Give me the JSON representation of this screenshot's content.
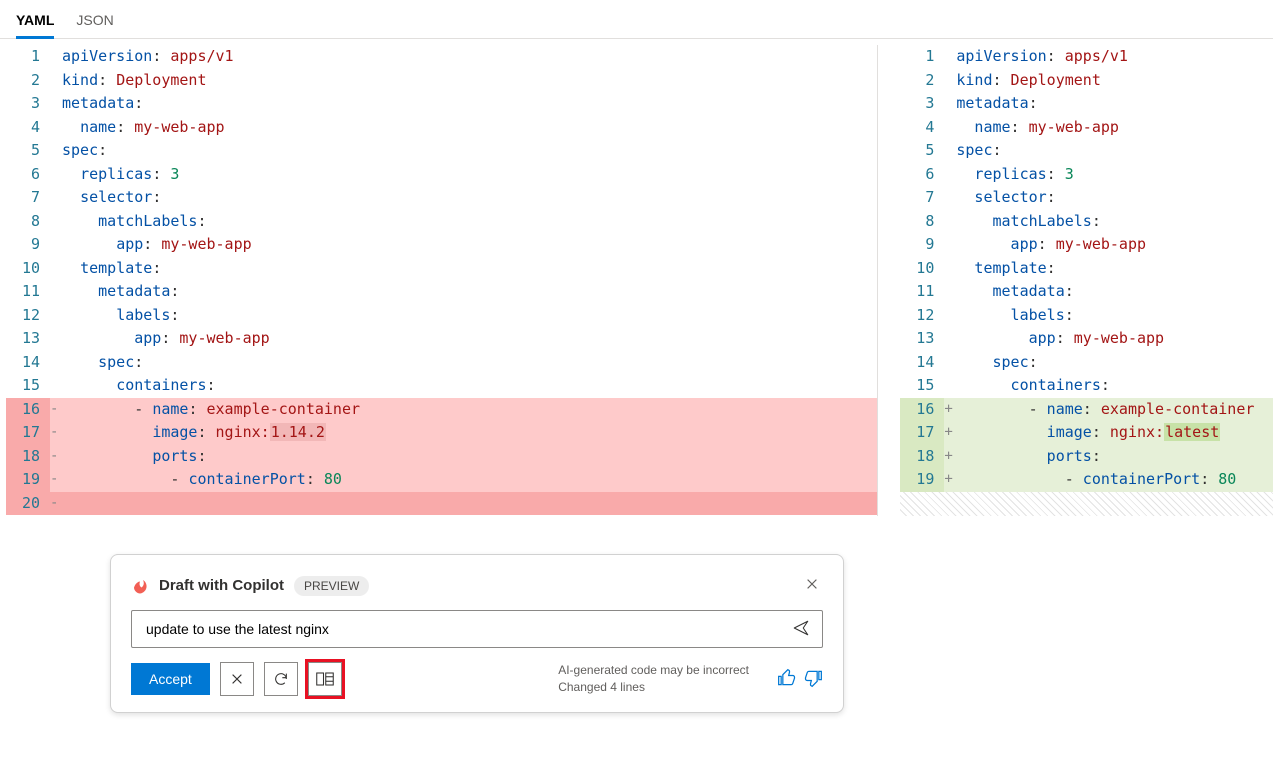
{
  "tabs": {
    "yaml": "YAML",
    "json": "JSON"
  },
  "left": {
    "lines": [
      {
        "n": 1,
        "tokens": [
          {
            "t": "apiVersion",
            "c": "k"
          },
          {
            "t": ": "
          },
          {
            "t": "apps/v1",
            "c": "v"
          }
        ]
      },
      {
        "n": 2,
        "tokens": [
          {
            "t": "kind",
            "c": "k"
          },
          {
            "t": ": "
          },
          {
            "t": "Deployment",
            "c": "v"
          }
        ]
      },
      {
        "n": 3,
        "tokens": [
          {
            "t": "metadata",
            "c": "k"
          },
          {
            "t": ":"
          }
        ]
      },
      {
        "n": 4,
        "tokens": [
          {
            "t": "  "
          },
          {
            "t": "name",
            "c": "k"
          },
          {
            "t": ": "
          },
          {
            "t": "my-web-app",
            "c": "v"
          }
        ]
      },
      {
        "n": 5,
        "tokens": [
          {
            "t": "spec",
            "c": "k"
          },
          {
            "t": ":"
          }
        ]
      },
      {
        "n": 6,
        "tokens": [
          {
            "t": "  "
          },
          {
            "t": "replicas",
            "c": "k"
          },
          {
            "t": ": "
          },
          {
            "t": "3",
            "c": "n"
          }
        ]
      },
      {
        "n": 7,
        "tokens": [
          {
            "t": "  "
          },
          {
            "t": "selector",
            "c": "k"
          },
          {
            "t": ":"
          }
        ]
      },
      {
        "n": 8,
        "tokens": [
          {
            "t": "    "
          },
          {
            "t": "matchLabels",
            "c": "k"
          },
          {
            "t": ":"
          }
        ]
      },
      {
        "n": 9,
        "tokens": [
          {
            "t": "      "
          },
          {
            "t": "app",
            "c": "k"
          },
          {
            "t": ": "
          },
          {
            "t": "my-web-app",
            "c": "v"
          }
        ]
      },
      {
        "n": 10,
        "tokens": [
          {
            "t": "  "
          },
          {
            "t": "template",
            "c": "k"
          },
          {
            "t": ":"
          }
        ]
      },
      {
        "n": 11,
        "tokens": [
          {
            "t": "    "
          },
          {
            "t": "metadata",
            "c": "k"
          },
          {
            "t": ":"
          }
        ]
      },
      {
        "n": 12,
        "tokens": [
          {
            "t": "      "
          },
          {
            "t": "labels",
            "c": "k"
          },
          {
            "t": ":"
          }
        ]
      },
      {
        "n": 13,
        "tokens": [
          {
            "t": "        "
          },
          {
            "t": "app",
            "c": "k"
          },
          {
            "t": ": "
          },
          {
            "t": "my-web-app",
            "c": "v"
          }
        ]
      },
      {
        "n": 14,
        "tokens": [
          {
            "t": "    "
          },
          {
            "t": "spec",
            "c": "k"
          },
          {
            "t": ":"
          }
        ]
      },
      {
        "n": 15,
        "tokens": [
          {
            "t": "      "
          },
          {
            "t": "containers",
            "c": "k"
          },
          {
            "t": ":"
          }
        ]
      },
      {
        "n": 16,
        "mark": "-",
        "cls": "del",
        "tokens": [
          {
            "t": "        - "
          },
          {
            "t": "name",
            "c": "k"
          },
          {
            "t": ": "
          },
          {
            "t": "example-container",
            "c": "v"
          }
        ]
      },
      {
        "n": 17,
        "mark": "-",
        "cls": "del",
        "tokens": [
          {
            "t": "          "
          },
          {
            "t": "image",
            "c": "k"
          },
          {
            "t": ": "
          },
          {
            "t": "nginx:",
            "c": "v"
          },
          {
            "t": "1.14.2",
            "c": "v",
            "hl": "old"
          }
        ]
      },
      {
        "n": 18,
        "mark": "-",
        "cls": "del",
        "tokens": [
          {
            "t": "          "
          },
          {
            "t": "ports",
            "c": "k"
          },
          {
            "t": ":"
          }
        ]
      },
      {
        "n": 19,
        "mark": "-",
        "cls": "del",
        "tokens": [
          {
            "t": "            - "
          },
          {
            "t": "containerPort",
            "c": "k"
          },
          {
            "t": ": "
          },
          {
            "t": "80",
            "c": "n"
          }
        ]
      },
      {
        "n": 20,
        "mark": "-",
        "cls": "del-strong",
        "tokens": []
      }
    ]
  },
  "right": {
    "lines": [
      {
        "n": 1,
        "tokens": [
          {
            "t": "apiVersion",
            "c": "k"
          },
          {
            "t": ": "
          },
          {
            "t": "apps/v1",
            "c": "v"
          }
        ]
      },
      {
        "n": 2,
        "tokens": [
          {
            "t": "kind",
            "c": "k"
          },
          {
            "t": ": "
          },
          {
            "t": "Deployment",
            "c": "v"
          }
        ]
      },
      {
        "n": 3,
        "tokens": [
          {
            "t": "metadata",
            "c": "k"
          },
          {
            "t": ":"
          }
        ]
      },
      {
        "n": 4,
        "tokens": [
          {
            "t": "  "
          },
          {
            "t": "name",
            "c": "k"
          },
          {
            "t": ": "
          },
          {
            "t": "my-web-app",
            "c": "v"
          }
        ]
      },
      {
        "n": 5,
        "tokens": [
          {
            "t": "spec",
            "c": "k"
          },
          {
            "t": ":"
          }
        ]
      },
      {
        "n": 6,
        "tokens": [
          {
            "t": "  "
          },
          {
            "t": "replicas",
            "c": "k"
          },
          {
            "t": ": "
          },
          {
            "t": "3",
            "c": "n"
          }
        ]
      },
      {
        "n": 7,
        "tokens": [
          {
            "t": "  "
          },
          {
            "t": "selector",
            "c": "k"
          },
          {
            "t": ":"
          }
        ]
      },
      {
        "n": 8,
        "tokens": [
          {
            "t": "    "
          },
          {
            "t": "matchLabels",
            "c": "k"
          },
          {
            "t": ":"
          }
        ]
      },
      {
        "n": 9,
        "tokens": [
          {
            "t": "      "
          },
          {
            "t": "app",
            "c": "k"
          },
          {
            "t": ": "
          },
          {
            "t": "my-web-app",
            "c": "v"
          }
        ]
      },
      {
        "n": 10,
        "tokens": [
          {
            "t": "  "
          },
          {
            "t": "template",
            "c": "k"
          },
          {
            "t": ":"
          }
        ]
      },
      {
        "n": 11,
        "tokens": [
          {
            "t": "    "
          },
          {
            "t": "metadata",
            "c": "k"
          },
          {
            "t": ":"
          }
        ]
      },
      {
        "n": 12,
        "tokens": [
          {
            "t": "      "
          },
          {
            "t": "labels",
            "c": "k"
          },
          {
            "t": ":"
          }
        ]
      },
      {
        "n": 13,
        "tokens": [
          {
            "t": "        "
          },
          {
            "t": "app",
            "c": "k"
          },
          {
            "t": ": "
          },
          {
            "t": "my-web-app",
            "c": "v"
          }
        ]
      },
      {
        "n": 14,
        "tokens": [
          {
            "t": "    "
          },
          {
            "t": "spec",
            "c": "k"
          },
          {
            "t": ":"
          }
        ]
      },
      {
        "n": 15,
        "tokens": [
          {
            "t": "      "
          },
          {
            "t": "containers",
            "c": "k"
          },
          {
            "t": ":"
          }
        ]
      },
      {
        "n": 16,
        "mark": "+",
        "cls": "add",
        "tokens": [
          {
            "t": "        - "
          },
          {
            "t": "name",
            "c": "k"
          },
          {
            "t": ": "
          },
          {
            "t": "example-container",
            "c": "v"
          }
        ]
      },
      {
        "n": 17,
        "mark": "+",
        "cls": "add",
        "tokens": [
          {
            "t": "          "
          },
          {
            "t": "image",
            "c": "k"
          },
          {
            "t": ": "
          },
          {
            "t": "nginx:",
            "c": "v"
          },
          {
            "t": "latest",
            "c": "v",
            "hl": "new"
          }
        ]
      },
      {
        "n": 18,
        "mark": "+",
        "cls": "add",
        "tokens": [
          {
            "t": "          "
          },
          {
            "t": "ports",
            "c": "k"
          },
          {
            "t": ":"
          }
        ]
      },
      {
        "n": 19,
        "mark": "+",
        "cls": "add",
        "tokens": [
          {
            "t": "            - "
          },
          {
            "t": "containerPort",
            "c": "k"
          },
          {
            "t": ": "
          },
          {
            "t": "80",
            "c": "n"
          }
        ]
      }
    ]
  },
  "copilot": {
    "title": "Draft with Copilot",
    "badge": "PREVIEW",
    "input_value": "update to use the latest nginx",
    "accept": "Accept",
    "note1": "AI-generated code may be incorrect",
    "note2": "Changed 4 lines"
  }
}
